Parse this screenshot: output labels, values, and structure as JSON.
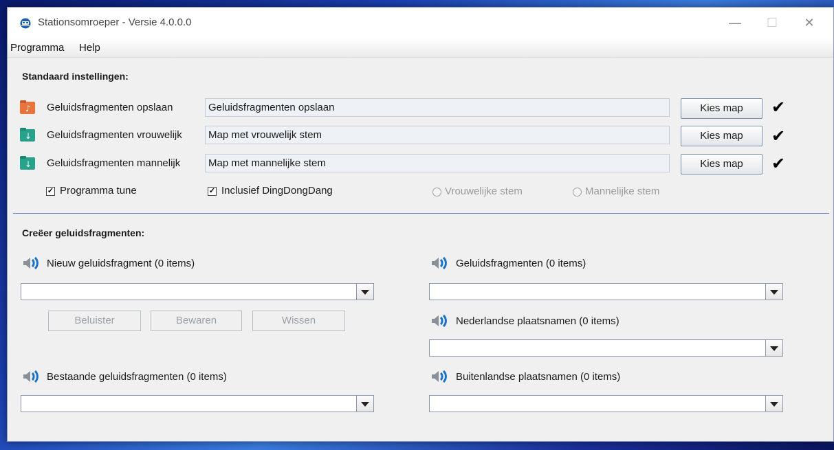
{
  "window": {
    "title": "Stationsomroeper - Versie 4.0.0.0"
  },
  "menu": {
    "items": [
      "Programma",
      "Help"
    ]
  },
  "settings": {
    "heading": "Standaard instellingen:",
    "rows": [
      {
        "label": "Geluidsfragmenten opslaan",
        "value": "Geluidsfragmenten opslaan",
        "button": "Kies map",
        "icon": "music-folder-icon",
        "icon_color": "#e8743b"
      },
      {
        "label": "Geluidsfragmenten vrouwelijk",
        "value": "Map met vrouwelijk stem",
        "button": "Kies map",
        "icon": "download-folder-icon",
        "icon_color": "#26a38a"
      },
      {
        "label": "Geluidsfragmenten mannelijk",
        "value": "Map met mannelijke stem",
        "button": "Kies map",
        "icon": "download-folder-icon",
        "icon_color": "#26a38a"
      }
    ],
    "programma_tune": "Programma tune",
    "inclusief": "Inclusief DingDongDang",
    "vrouwelijke": "Vrouwelijke stem",
    "mannelijke": "Mannelijke stem"
  },
  "create": {
    "heading": "Creëer geluidsfragmenten:",
    "nieuw": "Nieuw geluidsfragment (0 items)",
    "bestaande": "Bestaande geluidsfragmenten (0 items)",
    "geluidsfragmenten": "Geluidsfragmenten (0 items)",
    "nederlandse": "Nederlandse plaatsnamen (0 items)",
    "buitenlandse": "Buitenlandse plaatsnamen (0 items)",
    "beluister": "Beluister",
    "bewaren": "Bewaren",
    "wissen": "Wissen"
  },
  "colors": {
    "separator": "#5a7fb8",
    "speaker": "#1a72c8"
  }
}
